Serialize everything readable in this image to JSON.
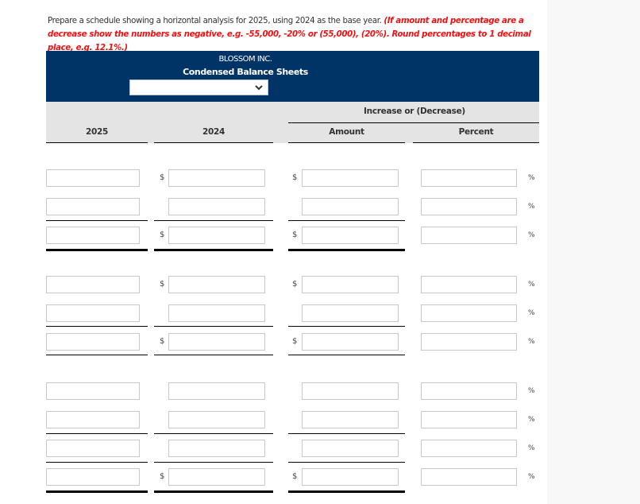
{
  "instructions": {
    "text": "Prepare a schedule showing a horizontal analysis for 2025, using 2024 as the base year.",
    "hint": "(If amount and percentage are a decrease show the numbers as negative, e.g. -55,000, -20% or (55,000), (20%). Round percentages to 1 decimal place, e.g. 12.1%.)"
  },
  "statement": {
    "company": "BLOSSOM INC.",
    "title": "Condensed Balance Sheets",
    "date_select": {
      "selected": "",
      "icon": "chevron-down-icon"
    }
  },
  "columns": {
    "group_header": "Increase or (Decrease)",
    "year_current": "2025",
    "year_base": "2024",
    "amount": "Amount",
    "percent": "Percent"
  },
  "symbols": {
    "currency": "$",
    "percent": "%"
  },
  "rows": [
    {
      "id": 1,
      "y2025": "",
      "y2024": "",
      "amount": "",
      "percent": "",
      "dollar_sign": true
    },
    {
      "id": 2,
      "y2025": "",
      "y2024": "",
      "amount": "",
      "percent": "",
      "dollar_sign": false
    },
    {
      "id": 3,
      "y2025": "",
      "y2024": "",
      "amount": "",
      "percent": "",
      "dollar_sign": true
    },
    {
      "id": 4,
      "y2025": "",
      "y2024": "",
      "amount": "",
      "percent": "",
      "dollar_sign": true
    },
    {
      "id": 5,
      "y2025": "",
      "y2024": "",
      "amount": "",
      "percent": "",
      "dollar_sign": false
    },
    {
      "id": 6,
      "y2025": "",
      "y2024": "",
      "amount": "",
      "percent": "",
      "dollar_sign": true
    },
    {
      "id": 7,
      "y2025": "",
      "y2024": "",
      "amount": "",
      "percent": "",
      "dollar_sign": false
    },
    {
      "id": 8,
      "y2025": "",
      "y2024": "",
      "amount": "",
      "percent": "",
      "dollar_sign": false
    },
    {
      "id": 9,
      "y2025": "",
      "y2024": "",
      "amount": "",
      "percent": "",
      "dollar_sign": false
    },
    {
      "id": 10,
      "y2025": "",
      "y2024": "",
      "amount": "",
      "percent": "",
      "dollar_sign": true
    }
  ]
}
